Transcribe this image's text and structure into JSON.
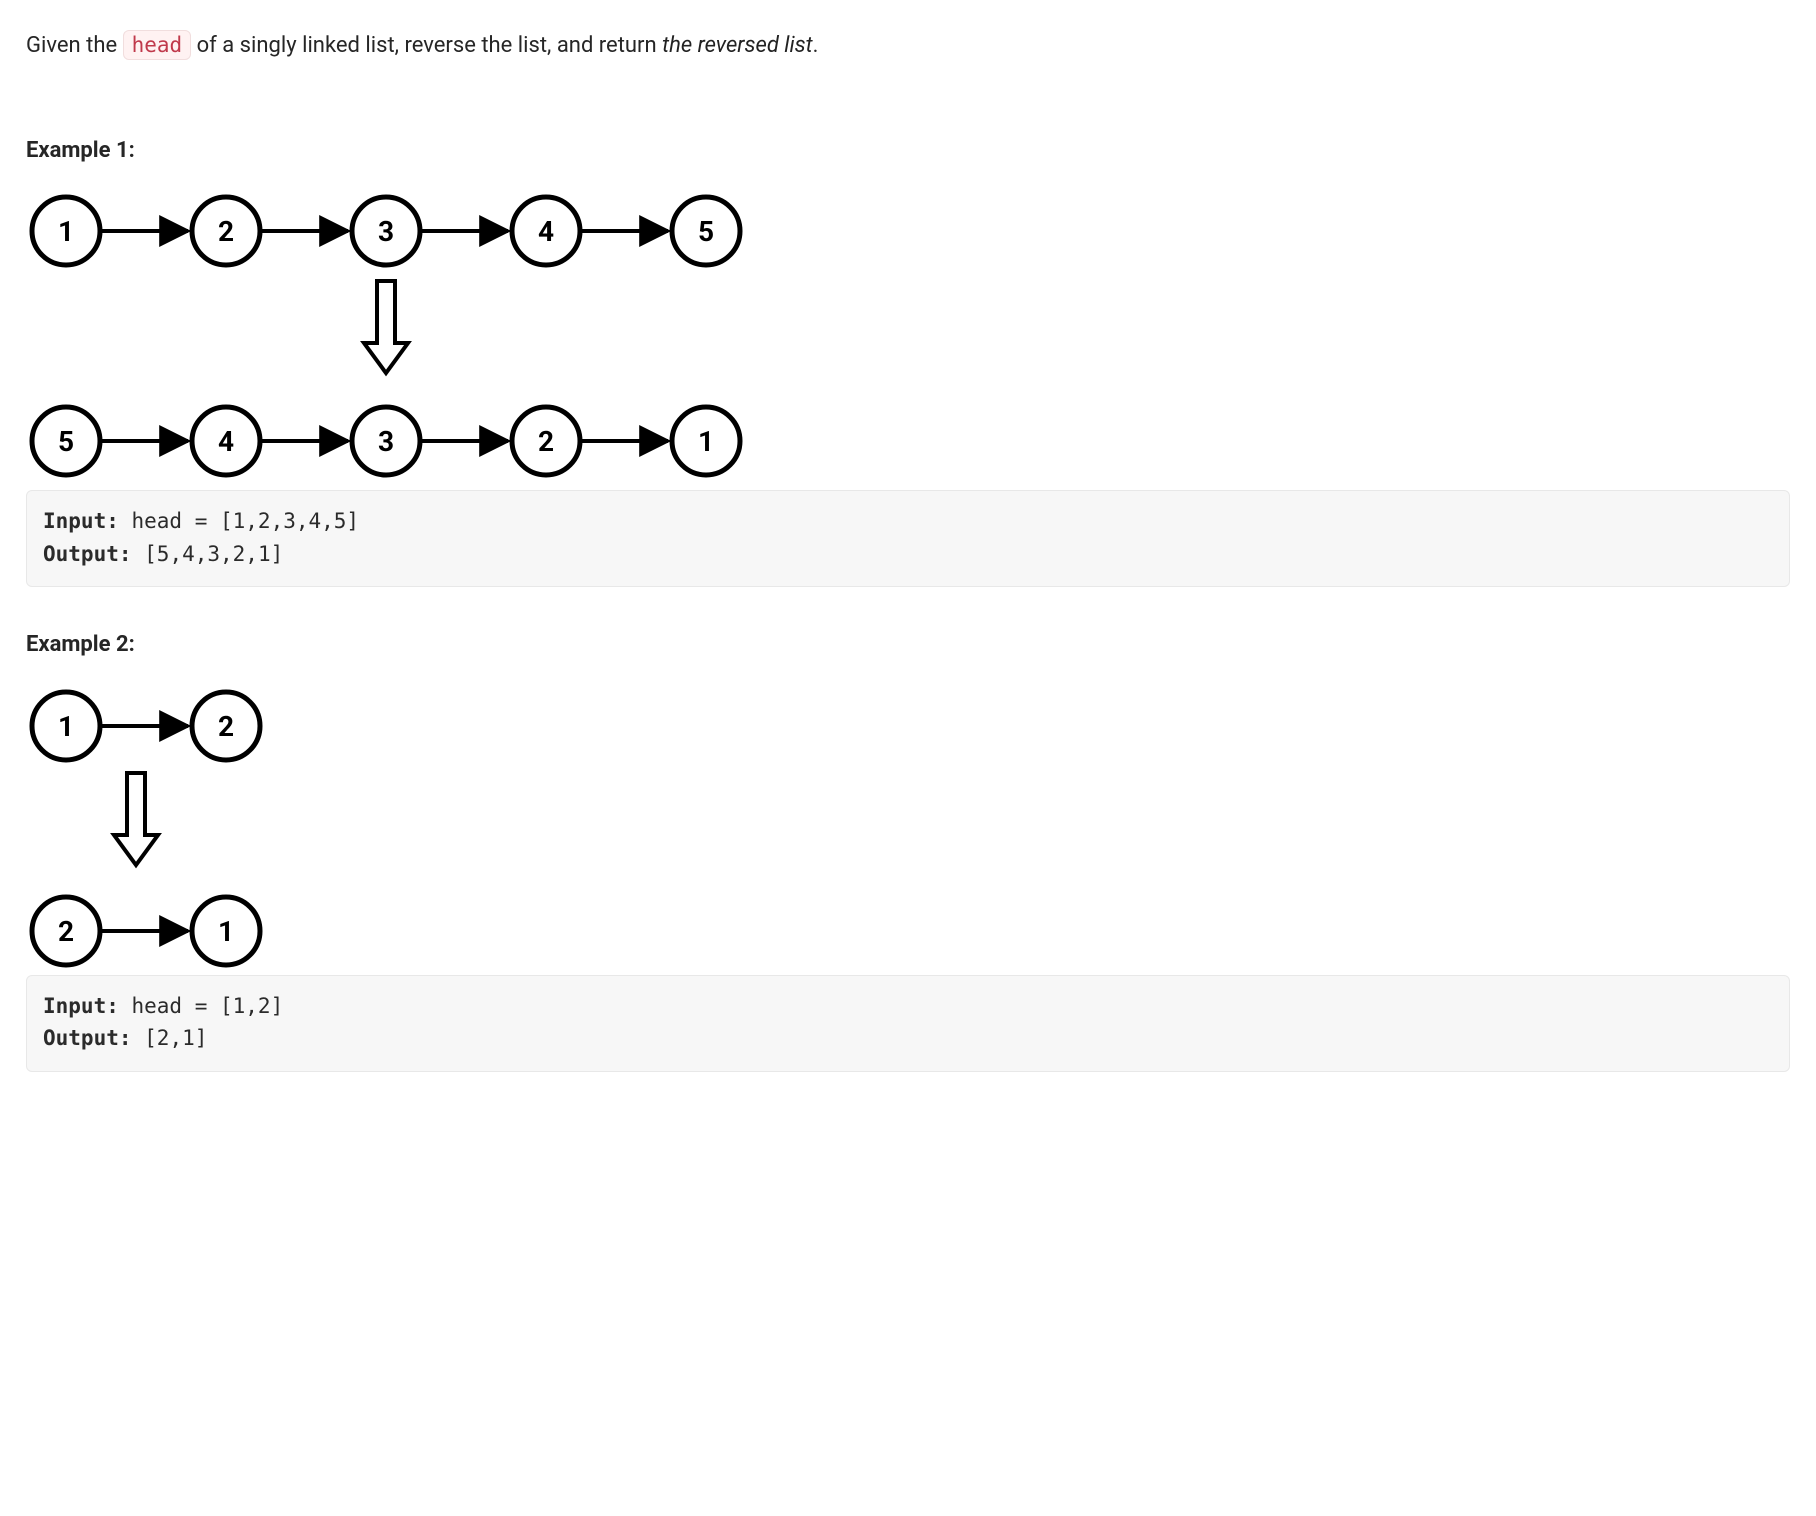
{
  "intro": {
    "prefix": "Given the ",
    "code": "head",
    "mid": " of a singly linked list, reverse the list, and return ",
    "italic": "the reversed list",
    "suffix": "."
  },
  "examples": [
    {
      "heading": "Example 1:",
      "input_label": "Input:",
      "input_value": " head = [1,2,3,4,5]",
      "output_label": "Output:",
      "output_value": " [5,4,3,2,1]",
      "diagram": {
        "top": [
          "1",
          "2",
          "3",
          "4",
          "5"
        ],
        "bottom": [
          "5",
          "4",
          "3",
          "2",
          "1"
        ]
      }
    },
    {
      "heading": "Example 2:",
      "input_label": "Input:",
      "input_value": " head = [1,2]",
      "output_label": "Output:",
      "output_value": " [2,1]",
      "diagram": {
        "top": [
          "1",
          "2"
        ],
        "bottom": [
          "2",
          "1"
        ]
      }
    }
  ]
}
